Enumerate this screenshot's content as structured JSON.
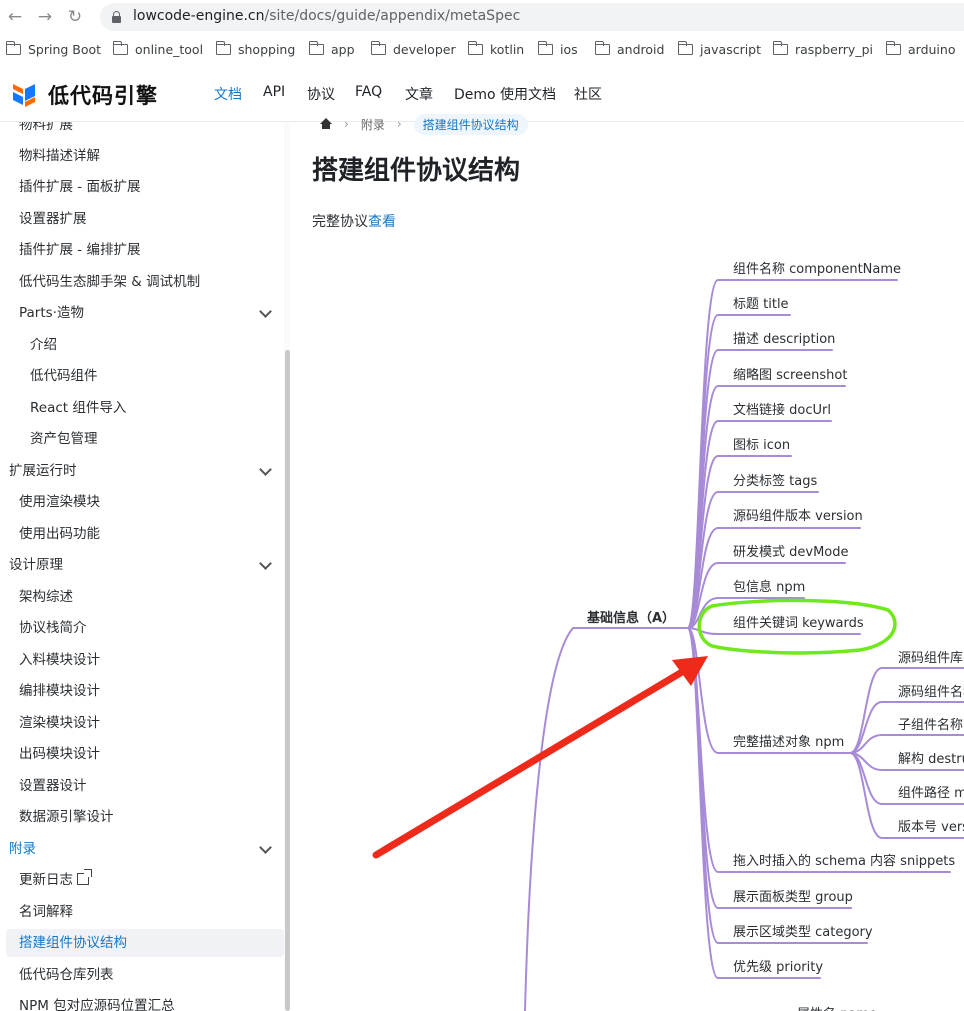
{
  "browser": {
    "url_host": "lowcode-engine.cn",
    "url_path": "/site/docs/guide/appendix/metaSpec",
    "nav_back": "←",
    "nav_forward": "→",
    "nav_reload": "↻",
    "bookmarks": [
      "Spring Boot",
      "online_tool",
      "shopping",
      "app",
      "developer",
      "kotlin",
      "ios",
      "android",
      "javascript",
      "raspberry_pi",
      "arduino"
    ]
  },
  "header": {
    "logo_text": "低代码引擎",
    "nav": [
      "文档",
      "API",
      "协议",
      "FAQ",
      "文章",
      "Demo 使用文档",
      "社区"
    ],
    "active_index": 0,
    "colors": {
      "accent": "#1677c8",
      "logo_orange": "#ff6a00",
      "logo_blue": "#1677ff"
    }
  },
  "sidebar": {
    "items": [
      {
        "label": "物料扩展",
        "level": 2
      },
      {
        "label": "物料描述详解",
        "level": 2
      },
      {
        "label": "插件扩展 - 面板扩展",
        "level": 2
      },
      {
        "label": "设置器扩展",
        "level": 2
      },
      {
        "label": "插件扩展 - 编排扩展",
        "level": 2
      },
      {
        "label": "低代码生态脚手架 & 调试机制",
        "level": 2
      },
      {
        "label": "Parts·造物",
        "level": 2,
        "expandable": true
      },
      {
        "label": "介绍",
        "level": 3
      },
      {
        "label": "低代码组件",
        "level": 3
      },
      {
        "label": "React 组件导入",
        "level": 3
      },
      {
        "label": "资产包管理",
        "level": 3
      },
      {
        "label": "扩展运行时",
        "level": 1,
        "expandable": true
      },
      {
        "label": "使用渲染模块",
        "level": 2
      },
      {
        "label": "使用出码功能",
        "level": 2
      },
      {
        "label": "设计原理",
        "level": 1,
        "expandable": true
      },
      {
        "label": "架构综述",
        "level": 2
      },
      {
        "label": "协议栈简介",
        "level": 2
      },
      {
        "label": "入料模块设计",
        "level": 2
      },
      {
        "label": "编排模块设计",
        "level": 2
      },
      {
        "label": "渲染模块设计",
        "level": 2
      },
      {
        "label": "出码模块设计",
        "level": 2
      },
      {
        "label": "设置器设计",
        "level": 2
      },
      {
        "label": "数据源引擎设计",
        "level": 2
      },
      {
        "label": "附录",
        "level": 1,
        "expandable": true,
        "active": true
      },
      {
        "label": "更新日志",
        "level": 2,
        "external": true
      },
      {
        "label": "名词解释",
        "level": 2
      },
      {
        "label": "搭建组件协议结构",
        "level": 2,
        "selected": true
      },
      {
        "label": "低代码仓库列表",
        "level": 2
      },
      {
        "label": "NPM 包对应源码位置汇总",
        "level": 2
      }
    ]
  },
  "breadcrumb": {
    "parent": "附录",
    "current": "搭建组件协议结构"
  },
  "page": {
    "title": "搭建组件协议结构",
    "intro_text": "完整协议",
    "intro_link": "查看"
  },
  "mindmap": {
    "root": "基础信息（A）",
    "children": [
      "组件名称 componentName",
      "标题 title",
      "描述 description",
      "缩略图 screenshot",
      "文档链接 docUrl",
      "图标 icon",
      "分类标签 tags",
      "源码组件版本 version",
      "研发模式 devMode",
      "包信息 npm",
      "组件关键词 keywards",
      "完整描述对象 npm",
      "拖入时插入的 schema 内容 snippets",
      "展示面板类型 group",
      "展示区域类型 category",
      "优先级 priority"
    ],
    "npm_children": [
      "源码组件库名",
      "源码组件名称",
      "子组件名称",
      "解构 destructuring",
      "组件路径 main",
      "版本号 version"
    ],
    "next_section": "属性名 name",
    "colors": {
      "branch": "#a78bd6",
      "highlight": "#6fe81c",
      "arrow": "#f02a1a"
    }
  }
}
